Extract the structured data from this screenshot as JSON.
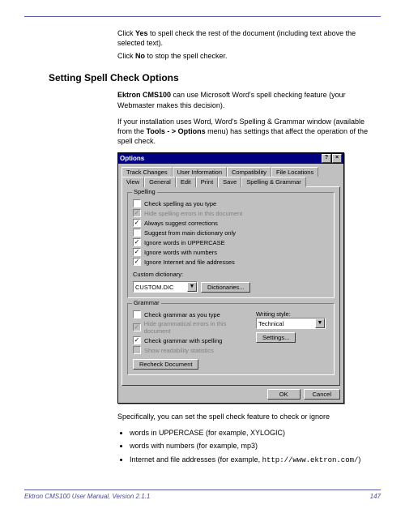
{
  "intro": {
    "line1_pre": "Click ",
    "line1_bold": "Yes",
    "line1_post": " to spell check the rest of the document (including text above the selected text).",
    "line2_pre": "Click ",
    "line2_bold": "No",
    "line2_post": " to stop the spell checker."
  },
  "heading": "Setting Spell Check Options",
  "body": {
    "p1_bold": "Ektron CMS100",
    "p1_post": " can use Microsoft Word's spell checking feature (your Webmaster makes this decision).",
    "p2_pre": "If your installation uses Word, Word's Spelling & Grammar window (available from the ",
    "p2_bold": "Tools - > Options",
    "p2_post": " menu) has settings that affect the operation of the spell check."
  },
  "dialog": {
    "title": "Options",
    "help_btn": "?",
    "close_btn": "×",
    "tabs_back": [
      "Track Changes",
      "User Information",
      "Compatibility",
      "File Locations"
    ],
    "tabs_front": [
      "View",
      "General",
      "Edit",
      "Print",
      "Save",
      "Spelling & Grammar"
    ],
    "spelling": {
      "group": "Spelling",
      "items": [
        {
          "checked": false,
          "disabled": false,
          "label": "Check spelling as you type"
        },
        {
          "checked": true,
          "disabled": true,
          "label": "Hide spelling errors in this document"
        },
        {
          "checked": true,
          "disabled": false,
          "label": "Always suggest corrections"
        },
        {
          "checked": false,
          "disabled": false,
          "label": "Suggest from main dictionary only"
        },
        {
          "checked": true,
          "disabled": false,
          "label": "Ignore words in UPPERCASE"
        },
        {
          "checked": true,
          "disabled": false,
          "label": "Ignore words with numbers"
        },
        {
          "checked": true,
          "disabled": false,
          "label": "Ignore Internet and file addresses"
        }
      ],
      "dict_label": "Custom dictionary:",
      "dict_value": "CUSTOM.DIC",
      "dict_btn": "Dictionaries..."
    },
    "grammar": {
      "group": "Grammar",
      "items": [
        {
          "checked": false,
          "disabled": false,
          "label": "Check grammar as you type"
        },
        {
          "checked": true,
          "disabled": true,
          "label": "Hide grammatical errors in this document"
        },
        {
          "checked": true,
          "disabled": false,
          "label": "Check grammar with spelling"
        },
        {
          "checked": false,
          "disabled": true,
          "label": "Show readability statistics"
        }
      ],
      "style_label": "Writing style:",
      "style_value": "Technical",
      "settings_btn": "Settings...",
      "recheck_btn": "Recheck Document"
    },
    "ok": "OK",
    "cancel": "Cancel"
  },
  "after_dialog": "Specifically, you can set the spell check feature to check or ignore",
  "bullets": {
    "b1": "words in UPPERCASE (for example, XYLOGIC)",
    "b2": "words with numbers (for example, mp3)",
    "b3_pre": "Internet and file addresses (for example, ",
    "b3_code": "http://www.ektron.com/",
    "b3_post": ")"
  },
  "footer": {
    "left": "Ektron CMS100 User Manual, Version 2.1.1",
    "right": "147"
  }
}
